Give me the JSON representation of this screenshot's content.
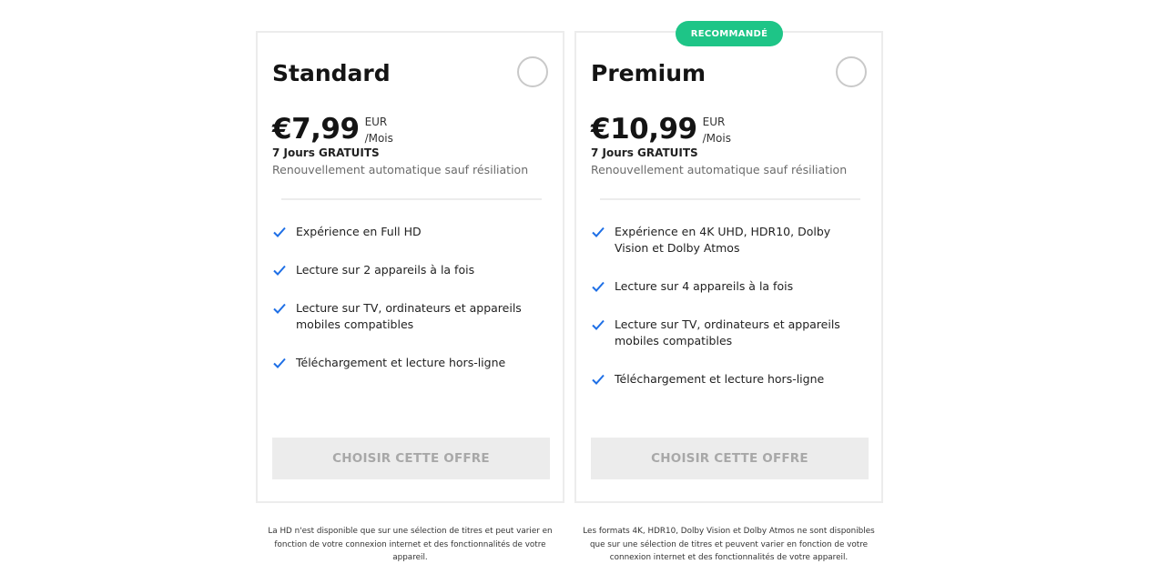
{
  "colors": {
    "accent_check": "#1e6fe6",
    "badge_bg": "#1ec587",
    "button_bg": "#ececec"
  },
  "plans": [
    {
      "name": "Standard",
      "price": "€7,99",
      "currency": "EUR",
      "period": "/Mois",
      "trial": "7 Jours GRATUITS",
      "renewal": "Renouvellement automatique sauf résiliation",
      "features": [
        "Expérience en Full HD",
        "Lecture sur 2 appareils à la fois",
        "Lecture sur TV, ordinateurs et appareils mobiles compatibles",
        "Téléchargement et lecture hors-ligne"
      ],
      "cta": "CHOISIR CETTE OFFRE",
      "note": "La HD n'est disponible que sur une sélection de titres et peut varier en fonction de votre connexion internet et des fonctionnalités de votre appareil."
    },
    {
      "badge": "RECOMMANDÉ",
      "name": "Premium",
      "price": "€10,99",
      "currency": "EUR",
      "period": "/Mois",
      "trial": "7 Jours GRATUITS",
      "renewal": "Renouvellement automatique sauf résiliation",
      "features": [
        "Expérience en 4K UHD, HDR10, Dolby Vision et Dolby Atmos",
        "Lecture sur 4 appareils à la fois",
        "Lecture sur TV, ordinateurs et appareils mobiles compatibles",
        "Téléchargement et lecture hors-ligne"
      ],
      "cta": "CHOISIR CETTE OFFRE",
      "note": "Les formats 4K, HDR10, Dolby Vision et Dolby Atmos ne sont disponibles que sur une sélection de titres et peuvent varier en fonction de votre connexion internet et des fonctionnalités de votre appareil."
    }
  ]
}
